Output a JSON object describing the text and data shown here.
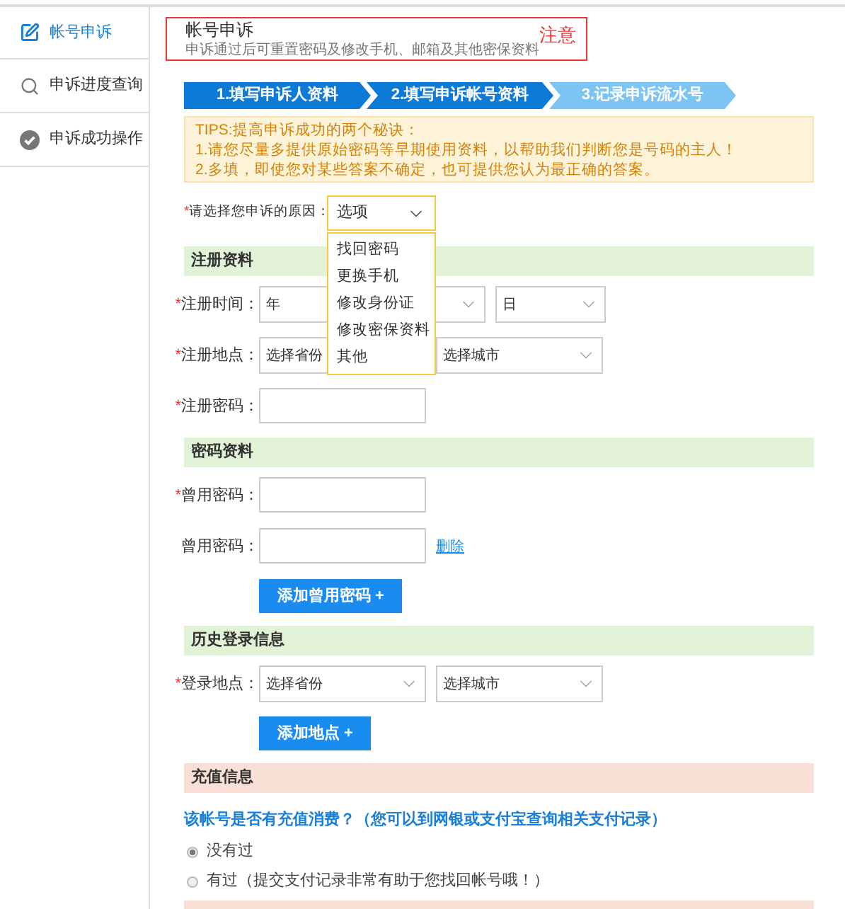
{
  "sidebar": {
    "items": [
      {
        "label": "帐号申诉",
        "kind": "edit",
        "selected": true
      },
      {
        "label": "申诉进度查询",
        "kind": "search",
        "selected": false
      },
      {
        "label": "申诉成功操作",
        "kind": "check",
        "selected": false
      }
    ]
  },
  "header": {
    "title": "帐号申诉",
    "subtitle": "申诉通过后可重置密码及修改手机、邮箱及其他密保资料",
    "note": "注意"
  },
  "steps": [
    {
      "label": "1.填写申诉人资料",
      "done": true
    },
    {
      "label": "2.填写申诉帐号资料",
      "done": true
    },
    {
      "label": "3.记录申诉流水号",
      "done": false
    }
  ],
  "tips": [
    "TIPS:提高申诉成功的两个秘诀：",
    "1.请您尽量多提供原始密码等早期使用资料，以帮助我们判断您是号码的主人！",
    "2.多填，即使您对某些答案不确定，也可提供您认为最正确的答案。"
  ],
  "reason": {
    "label": "请选择您申诉的原因：",
    "mark": "*",
    "value": "选项",
    "open": true,
    "options": [
      "找回密码",
      "更换手机",
      "修改身份证",
      "修改密保资料",
      "其他"
    ]
  },
  "sections": [
    {
      "title": "注册资料",
      "kind": "green",
      "rows": [
        {
          "kind": "selects",
          "label": "注册时间：",
          "mark": "*",
          "selects": [
            {
              "value": "年",
              "kind": "wide"
            },
            {
              "value": "日",
              "kind": "small"
            }
          ]
        },
        {
          "kind": "selects",
          "label": "注册地点：",
          "mark": "*",
          "selects": [
            {
              "value": "选择省份",
              "kind": "normal"
            },
            {
              "value": "选择城市",
              "kind": "normal"
            }
          ]
        },
        {
          "kind": "input",
          "label": "注册密码：",
          "mark": "*"
        }
      ]
    },
    {
      "title": "密码资料",
      "kind": "green",
      "rows": [
        {
          "kind": "input",
          "label": "曾用密码：",
          "mark": "*"
        },
        {
          "kind": "input",
          "label": "曾用密码：",
          "link": "删除"
        },
        {
          "kind": "button",
          "label": "添加曾用密码 +"
        }
      ]
    },
    {
      "title": "历史登录信息",
      "kind": "green",
      "rows": [
        {
          "kind": "selects",
          "label": "登录地点：",
          "mark": "*",
          "selects": [
            {
              "value": "选择省份",
              "kind": "normal"
            },
            {
              "value": "选择城市",
              "kind": "normal"
            }
          ]
        },
        {
          "kind": "button",
          "label": "添加地点 +"
        }
      ]
    },
    {
      "title": "充值信息",
      "kind": "peach",
      "rows": [
        {
          "kind": "question",
          "label": "该帐号是否有充值消费？（您可以到网银或支付宝查询相关支付记录）"
        },
        {
          "kind": "radio",
          "label": "没有过",
          "selected": true
        },
        {
          "kind": "radio",
          "label": "有过（提交支付记录非常有助于您找回帐号哦！）",
          "selected": false
        }
      ]
    }
  ]
}
